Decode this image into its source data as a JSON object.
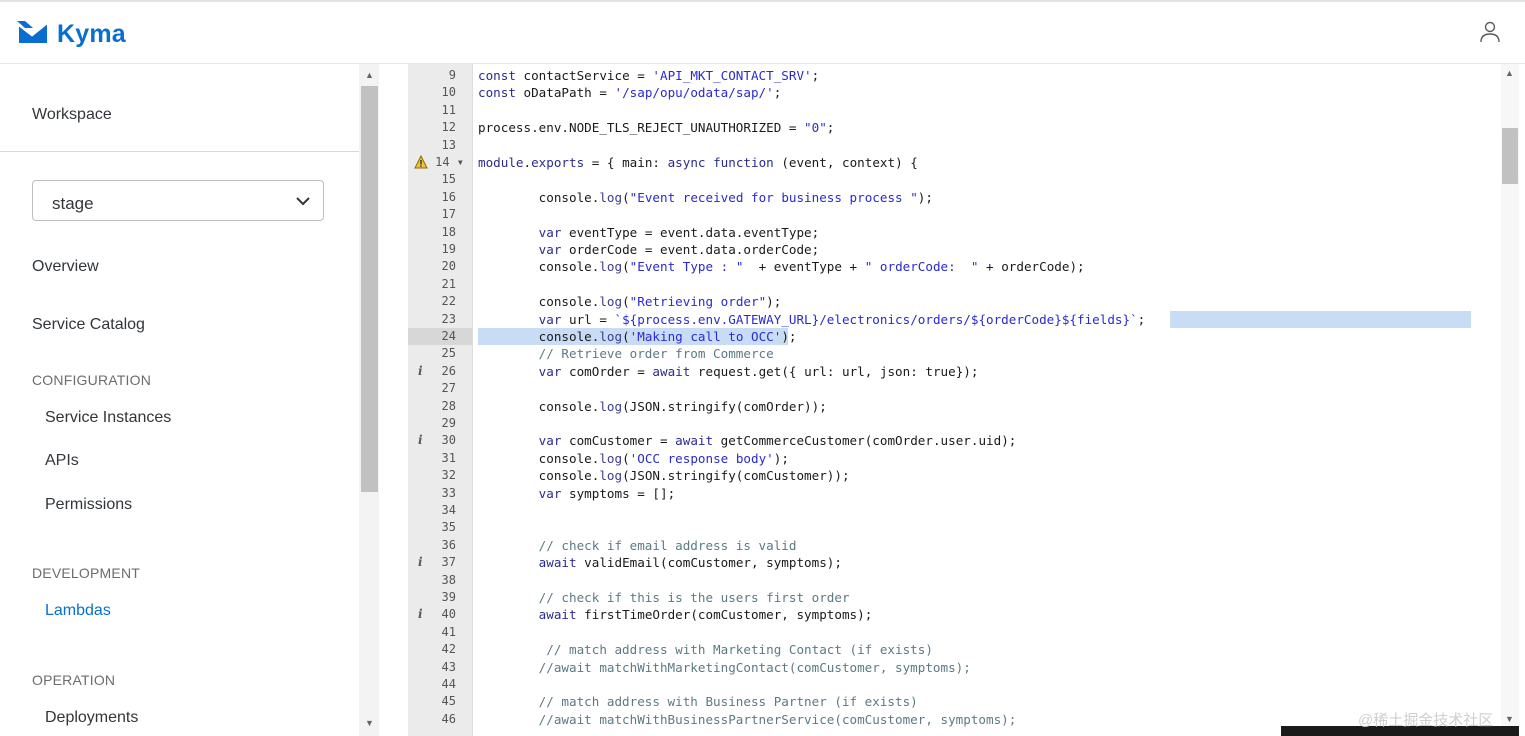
{
  "app": {
    "title": "Kyma"
  },
  "sidebar": {
    "workspace_label": "Workspace",
    "namespace_selected": "stage",
    "items": [
      {
        "label": "Overview"
      },
      {
        "label": "Service Catalog"
      }
    ],
    "sections": [
      {
        "title": "CONFIGURATION",
        "items": [
          {
            "label": "Service Instances"
          },
          {
            "label": "APIs"
          },
          {
            "label": "Permissions"
          }
        ]
      },
      {
        "title": "DEVELOPMENT",
        "items": [
          {
            "label": "Lambdas"
          }
        ]
      },
      {
        "title": "OPERATION",
        "items": [
          {
            "label": "Deployments"
          }
        ]
      }
    ]
  },
  "editor": {
    "lines": [
      {
        "n": "9",
        "text": "const contactService = 'API_MKT_CONTACT_SRV';"
      },
      {
        "n": "10",
        "text": "const oDataPath = '/sap/opu/odata/sap/';"
      },
      {
        "n": "11",
        "text": ""
      },
      {
        "n": "12",
        "text": "process.env.NODE_TLS_REJECT_UNAUTHORIZED = \"0\";"
      },
      {
        "n": "13",
        "text": ""
      },
      {
        "n": "14",
        "text": "module.exports = { main: async function (event, context) {"
      },
      {
        "n": "15",
        "text": ""
      },
      {
        "n": "16",
        "text": "        console.log(\"Event received for business process \");"
      },
      {
        "n": "17",
        "text": ""
      },
      {
        "n": "18",
        "text": "        var eventType = event.data.eventType;"
      },
      {
        "n": "19",
        "text": "        var orderCode = event.data.orderCode;"
      },
      {
        "n": "20",
        "text": "        console.log(\"Event Type : \"  + eventType + \" orderCode:  \" + orderCode);"
      },
      {
        "n": "21",
        "text": ""
      },
      {
        "n": "22",
        "text": "        console.log(\"Retrieving order\");"
      },
      {
        "n": "23",
        "text": "        var url = `${process.env.GATEWAY_URL}/electronics/orders/${orderCode}${fields}`;"
      },
      {
        "n": "24",
        "text": "        console.log('Making call to OCC');"
      },
      {
        "n": "25",
        "text": "        // Retrieve order from Commerce"
      },
      {
        "n": "26",
        "text": "        var comOrder = await request.get({ url: url, json: true});"
      },
      {
        "n": "27",
        "text": ""
      },
      {
        "n": "28",
        "text": "        console.log(JSON.stringify(comOrder));"
      },
      {
        "n": "29",
        "text": ""
      },
      {
        "n": "30",
        "text": "        var comCustomer = await getCommerceCustomer(comOrder.user.uid);"
      },
      {
        "n": "31",
        "text": "        console.log('OCC response body');"
      },
      {
        "n": "32",
        "text": "        console.log(JSON.stringify(comCustomer));"
      },
      {
        "n": "33",
        "text": "        var symptoms = [];"
      },
      {
        "n": "34",
        "text": ""
      },
      {
        "n": "35",
        "text": ""
      },
      {
        "n": "36",
        "text": "        // check if email address is valid"
      },
      {
        "n": "37",
        "text": "        await validEmail(comCustomer, symptoms);"
      },
      {
        "n": "38",
        "text": ""
      },
      {
        "n": "39",
        "text": "        // check if this is the users first order"
      },
      {
        "n": "40",
        "text": "        await firstTimeOrder(comCustomer, symptoms);"
      },
      {
        "n": "41",
        "text": ""
      },
      {
        "n": "42",
        "text": "         // match address with Marketing Contact (if exists)"
      },
      {
        "n": "43",
        "text": "        //await matchWithMarketingContact(comCustomer, symptoms);"
      },
      {
        "n": "44",
        "text": ""
      },
      {
        "n": "45",
        "text": "        // match address with Business Partner (if exists)"
      },
      {
        "n": "46",
        "text": "        //await matchWithBusinessPartnerService(comCustomer, symptoms);"
      }
    ],
    "info_lines": [
      "26",
      "30",
      "37",
      "40"
    ],
    "warning_line": "14",
    "fold_line": "14",
    "selected_line": "24"
  },
  "watermark": "@稀土掘金技术社区"
}
